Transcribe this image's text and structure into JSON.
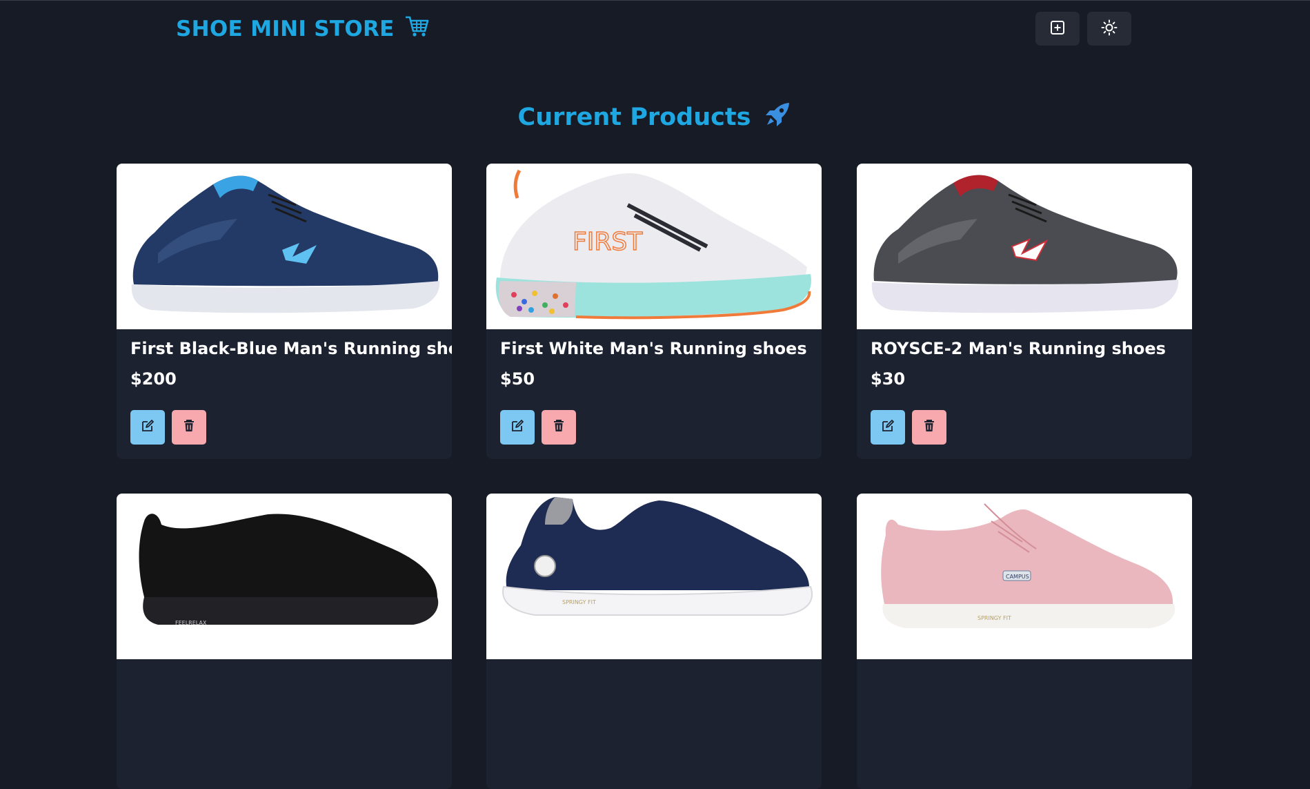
{
  "brand": {
    "title": "SHOE MINI STORE",
    "icon": "shopping-cart-icon",
    "color": "#1ea7e1"
  },
  "header": {
    "add_icon": "plus-square-icon",
    "theme_icon": "sun-icon"
  },
  "page": {
    "title": "Current Products",
    "title_icon": "rocket-icon"
  },
  "colors": {
    "background": "#171b26",
    "card": "#1d2230",
    "edit": "#7cc8f3",
    "delete": "#f8a9ae",
    "accent": "#1ea7e1"
  },
  "products": [
    {
      "name": "First Black-Blue Man's Running shoes",
      "price": "$200",
      "shoe": "navy",
      "edit_icon": "edit-icon",
      "delete_icon": "trash-icon"
    },
    {
      "name": "First White Man's Running shoes",
      "price": "$50",
      "shoe": "white",
      "edit_icon": "edit-icon",
      "delete_icon": "trash-icon"
    },
    {
      "name": "ROYSCE-2 Man's Running shoes",
      "price": "$30",
      "shoe": "grey",
      "edit_icon": "edit-icon",
      "delete_icon": "trash-icon"
    },
    {
      "name": "",
      "price": "",
      "shoe": "black"
    },
    {
      "name": "",
      "price": "",
      "shoe": "navy-slip"
    },
    {
      "name": "",
      "price": "",
      "shoe": "pink"
    }
  ]
}
